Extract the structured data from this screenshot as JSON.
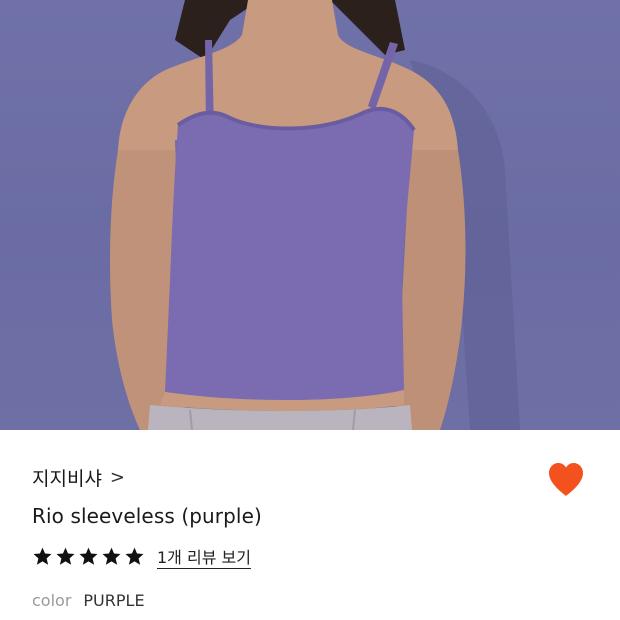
{
  "product": {
    "image_icon": "product-photo",
    "brand": "지지비샤",
    "brand_chevron": ">",
    "name": "Rio sleeveless (purple)",
    "rating_stars": 5,
    "review_link": "1개 리뷰 보기",
    "option_label": "color",
    "option_value": "PURPLE",
    "favorite_icon": "heart-icon",
    "favorited": true
  },
  "colors": {
    "heart": "#f3521e",
    "star": "#111111",
    "background_photo": "#6c6ea6",
    "top": "#7a6bb0"
  }
}
